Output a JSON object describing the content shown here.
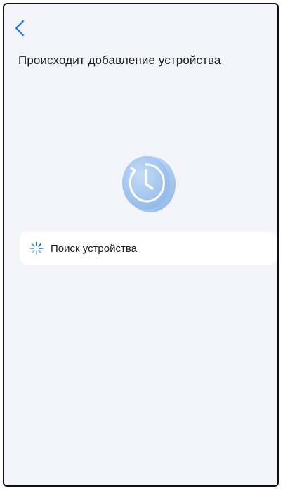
{
  "header": {
    "back_icon": "chevron-left-icon",
    "title": "Происходит добавление устройства"
  },
  "illustration": {
    "icon": "clock-icon"
  },
  "status": {
    "icon": "loading-spinner-icon",
    "label": "Поиск устройства"
  },
  "colors": {
    "accent": "#1a73e8",
    "background": "#f3f5fa",
    "card": "#ffffff",
    "illustration": "#a9cbf2"
  }
}
